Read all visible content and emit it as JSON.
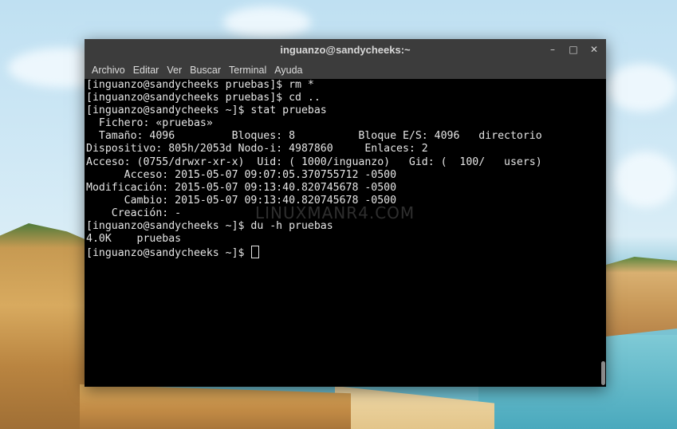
{
  "window": {
    "title": "inguanzo@sandycheeks:~",
    "controls": [
      "minimize-icon",
      "maximize-icon",
      "close-icon"
    ]
  },
  "menu": [
    "Archivo",
    "Editar",
    "Ver",
    "Buscar",
    "Terminal",
    "Ayuda"
  ],
  "terminal": {
    "lines": [
      "[inguanzo@sandycheeks pruebas]$ rm *",
      "[inguanzo@sandycheeks pruebas]$ cd ..",
      "[inguanzo@sandycheeks ~]$ stat pruebas",
      "  Fichero: «pruebas»",
      "  Tamaño: 4096         Bloques: 8          Bloque E/S: 4096   directorio",
      "Dispositivo: 805h/2053d Nodo-i: 4987860     Enlaces: 2",
      "Acceso: (0755/drwxr-xr-x)  Uid: ( 1000/inguanzo)   Gid: (  100/   users)",
      "      Acceso: 2015-05-07 09:07:05.370755712 -0500",
      "Modificación: 2015-05-07 09:13:40.820745678 -0500",
      "      Cambio: 2015-05-07 09:13:40.820745678 -0500",
      "    Creación: -",
      "[inguanzo@sandycheeks ~]$ du -h pruebas",
      "4.0K    pruebas"
    ],
    "prompt": "[inguanzo@sandycheeks ~]$ "
  },
  "watermark": "LINUXMANR4.COM",
  "colors": {
    "titlebar": "#3c3c3c",
    "terminal_bg": "#000000",
    "terminal_fg": "#e5e5e5"
  }
}
